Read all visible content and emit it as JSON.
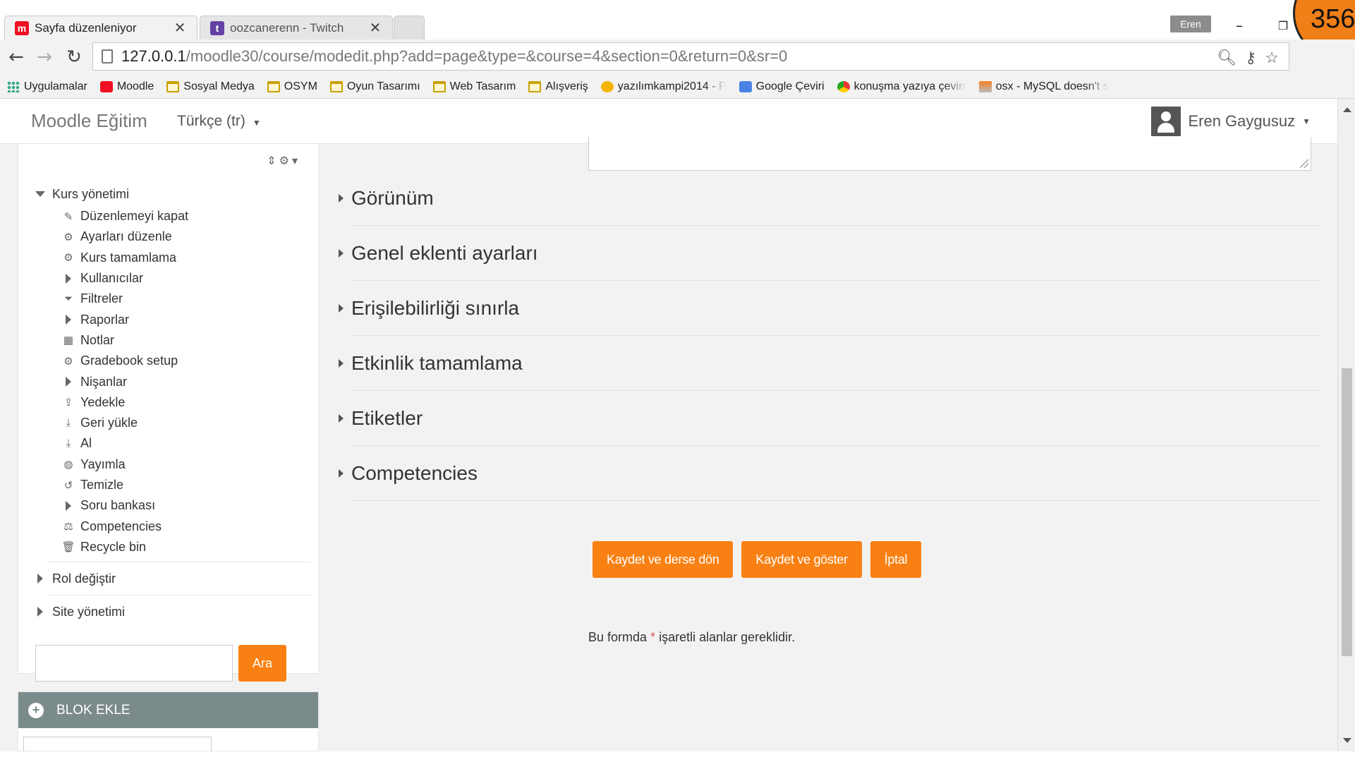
{
  "browser": {
    "profile_name": "Eren",
    "counter": "356",
    "tabs": [
      {
        "title": "Sayfa düzenleniyor",
        "active": true
      },
      {
        "title": "oozcanerenn - Twitch",
        "active": false
      }
    ],
    "url_host": "127.0.0.1",
    "url_path": "/moodle30/course/modedit.php?add=page&type=&course=4&section=0&return=0&sr=0",
    "bookmarks": [
      {
        "label": "Uygulamalar",
        "icon": "apps-icon"
      },
      {
        "label": "Moodle",
        "icon": "moodle-icon"
      },
      {
        "label": "Sosyal Medya",
        "icon": "folder-icon"
      },
      {
        "label": "OSYM",
        "icon": "folder-icon"
      },
      {
        "label": "Oyun Tasarımı",
        "icon": "folder-icon"
      },
      {
        "label": "Web Tasarım",
        "icon": "folder-icon"
      },
      {
        "label": "Alışveriş",
        "icon": "folder-icon"
      },
      {
        "label": "yazılımkampi2014 - P",
        "icon": "tiger-icon"
      },
      {
        "label": "Google Çeviri",
        "icon": "translate-icon"
      },
      {
        "label": "konuşma yazıya çevirr",
        "icon": "chrome-icon"
      },
      {
        "label": "osx - MySQL doesn't s",
        "icon": "stackoverflow-icon"
      }
    ]
  },
  "navbar": {
    "brand": "Moodle Eğitim",
    "language": "Türkçe (tr)",
    "user_name": "Eren Gaygusuz"
  },
  "sidebar": {
    "root_label": "Kurs yönetimi",
    "items": [
      {
        "label": "Düzenlemeyi kapat",
        "icon": "pencil-icon"
      },
      {
        "label": "Ayarları düzenle",
        "icon": "gear-icon"
      },
      {
        "label": "Kurs tamamlama",
        "icon": "gear-icon"
      },
      {
        "label": "Kullanıcılar",
        "icon": "expand-arrow-icon"
      },
      {
        "label": "Filtreler",
        "icon": "filter-icon"
      },
      {
        "label": "Raporlar",
        "icon": "expand-arrow-icon"
      },
      {
        "label": "Notlar",
        "icon": "table-icon"
      },
      {
        "label": "Gradebook setup",
        "icon": "gear-icon"
      },
      {
        "label": "Nişanlar",
        "icon": "expand-arrow-icon"
      },
      {
        "label": "Yedekle",
        "icon": "upload-icon"
      },
      {
        "label": "Geri yükle",
        "icon": "download-icon"
      },
      {
        "label": "Al",
        "icon": "download-icon"
      },
      {
        "label": "Yayımla",
        "icon": "globe-icon"
      },
      {
        "label": "Temizle",
        "icon": "reset-icon"
      },
      {
        "label": "Soru bankası",
        "icon": "expand-arrow-icon"
      },
      {
        "label": "Competencies",
        "icon": "competencies-icon"
      },
      {
        "label": "Recycle bin",
        "icon": "trash-icon"
      }
    ],
    "role_label": "Rol değiştir",
    "site_admin_label": "Site yönetimi",
    "search_button": "Ara",
    "add_block_label": "BLOK EKLE"
  },
  "form": {
    "sections": [
      "Görünüm",
      "Genel eklenti ayarları",
      "Erişilebilirliği sınırla",
      "Etkinlik tamamlama",
      "Etiketler",
      "Competencies"
    ],
    "buttons": {
      "save_return": "Kaydet ve derse dön",
      "save_display": "Kaydet ve göster",
      "cancel": "İptal"
    },
    "required_note_before": "Bu formda ",
    "required_note_star": "*",
    "required_note_after": " işaretli alanlar gereklidir."
  },
  "colors": {
    "accent_orange": "#f98012",
    "add_block_header": "#7b8a8b",
    "required_star": "#d9534f"
  }
}
